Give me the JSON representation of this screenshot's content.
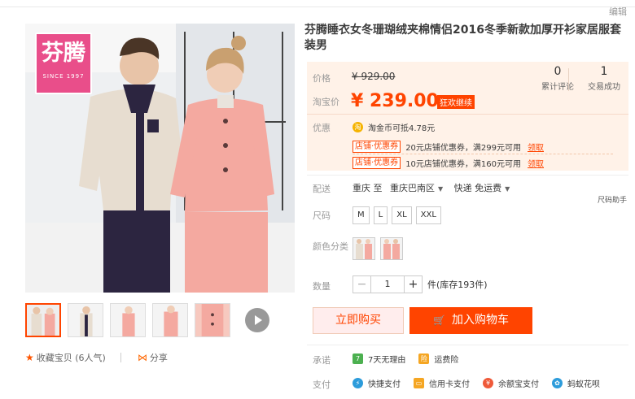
{
  "header": {
    "edit_link": "编辑"
  },
  "gallery": {
    "brand_logo": {
      "name": "芬腾",
      "tagline": "SINCE 1997"
    },
    "thumbnails_count": 5
  },
  "social": {
    "favorite": "收藏宝贝 (6人气)",
    "share": "分享"
  },
  "product": {
    "title": "芬腾睡衣女冬珊瑚绒夹棉情侣2016冬季新款加厚开衫家居服套装男",
    "price_label": "价格",
    "original_price": "¥ 929.00",
    "promo_label": "淘宝价",
    "promo_price": "¥ 239.00",
    "promo_tag": "狂欢继续",
    "reviews_count": "0",
    "reviews_label": "累计评论",
    "sales_count": "1",
    "sales_label": "交易成功",
    "discount_label": "优惠",
    "coin_text": "淘金币可抵4.78元",
    "coupons": [
      {
        "tag": "店铺·优惠券",
        "text": "20元店铺优惠券，满299元可用",
        "action": "领取"
      },
      {
        "tag": "店铺·优惠券",
        "text": "10元店铺优惠券，满160元可用",
        "action": "领取"
      }
    ]
  },
  "shipping": {
    "label": "配送",
    "from": "重庆 至",
    "to": "重庆巴南区",
    "method": "快递 免运费"
  },
  "size_chart": "尺码助手",
  "size": {
    "label": "尺码",
    "options": [
      "M",
      "L",
      "XL",
      "XXL"
    ]
  },
  "color": {
    "label": "颜色分类"
  },
  "quantity": {
    "label": "数量",
    "value": "1",
    "stock": "件(库存193件)"
  },
  "actions": {
    "buy_now": "立即购买",
    "add_to_cart": "加入购物车"
  },
  "promise": {
    "label": "承诺",
    "items": [
      "7天无理由",
      "运费险"
    ]
  },
  "payment": {
    "label": "支付",
    "items": [
      "快捷支付",
      "信用卡支付",
      "余额宝支付",
      "蚂蚁花呗"
    ]
  },
  "colors": {
    "accent": "#ff4400",
    "price_bg": "#fff2e8",
    "brand_pink": "#e94e8a"
  }
}
